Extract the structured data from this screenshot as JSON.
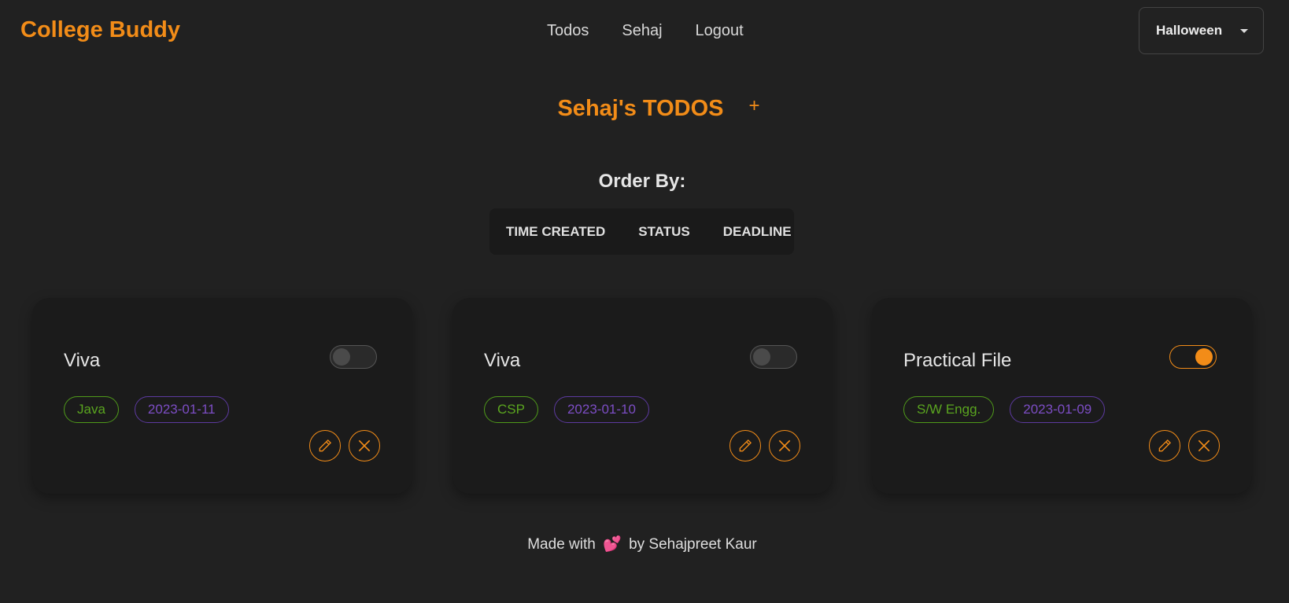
{
  "nav": {
    "brand": "College Buddy",
    "links": [
      "Todos",
      "Sehaj",
      "Logout"
    ],
    "theme": {
      "selected": "Halloween"
    }
  },
  "header": {
    "title": "Sehaj's TODOS",
    "add_label": "+"
  },
  "order": {
    "label": "Order By:",
    "options": [
      "TIME CREATED",
      "STATUS",
      "DEADLINE"
    ]
  },
  "todos": [
    {
      "title": "Viva",
      "subject": "Java",
      "deadline": "2023-01-11",
      "done": false
    },
    {
      "title": "Viva",
      "subject": "CSP",
      "deadline": "2023-01-10",
      "done": false
    },
    {
      "title": "Practical File",
      "subject": "S/W Engg.",
      "deadline": "2023-01-09",
      "done": true
    }
  ],
  "footer": {
    "prefix": "Made with",
    "heart": "💕",
    "suffix": "by Sehajpreet Kaur"
  },
  "colors": {
    "accent": "#f28c18",
    "subject_tag": "#5aa51f",
    "date_tag": "#7c4dc4",
    "background": "#212121"
  }
}
